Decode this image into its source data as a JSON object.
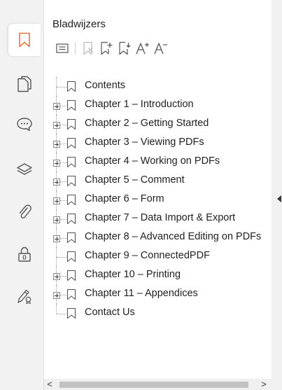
{
  "panel": {
    "title": "Bladwijzers"
  },
  "rail": {
    "tabs": [
      {
        "id": "bookmarks",
        "icon": "bookmark-icon",
        "active": true
      },
      {
        "id": "pages",
        "icon": "pages-icon",
        "active": false
      },
      {
        "id": "comments",
        "icon": "comment-icon",
        "active": false
      },
      {
        "id": "layers",
        "icon": "layers-icon",
        "active": false
      },
      {
        "id": "attachments",
        "icon": "paperclip-icon",
        "active": false
      },
      {
        "id": "security",
        "icon": "lock-icon",
        "active": false
      },
      {
        "id": "signatures",
        "icon": "signature-icon",
        "active": false
      }
    ]
  },
  "toolbar": {
    "buttons": [
      "bookmark-options-icon",
      "delete-bookmark-icon",
      "add-bookmark-icon",
      "add-child-bookmark-icon",
      "increase-font-icon",
      "decrease-font-icon"
    ]
  },
  "bookmarks": [
    {
      "label": "Contents",
      "expandable": false
    },
    {
      "label": "Chapter 1 – Introduction",
      "expandable": true
    },
    {
      "label": "Chapter 2 – Getting Started",
      "expandable": true
    },
    {
      "label": "Chapter 3 – Viewing PDFs",
      "expandable": true
    },
    {
      "label": "Chapter 4 – Working on PDFs",
      "expandable": true
    },
    {
      "label": "Chapter 5 – Comment",
      "expandable": true
    },
    {
      "label": "Chapter 6 – Form",
      "expandable": true
    },
    {
      "label": "Chapter 7 – Data Import & Export",
      "expandable": true
    },
    {
      "label": "Chapter 8 – Advanced Editing on PDFs",
      "expandable": true
    },
    {
      "label": "Chapter 9 – ConnectedPDF",
      "expandable": false
    },
    {
      "label": "Chapter 10 – Printing",
      "expandable": true
    },
    {
      "label": "Chapter 11 – Appendices",
      "expandable": true
    },
    {
      "label": "Contact Us",
      "expandable": false
    }
  ],
  "scrollbar": {
    "left_arrow": "<",
    "right_arrow": ">"
  },
  "colors": {
    "accent": "#e8753a",
    "icon": "#555555",
    "disabled": "#b8b8b8"
  }
}
